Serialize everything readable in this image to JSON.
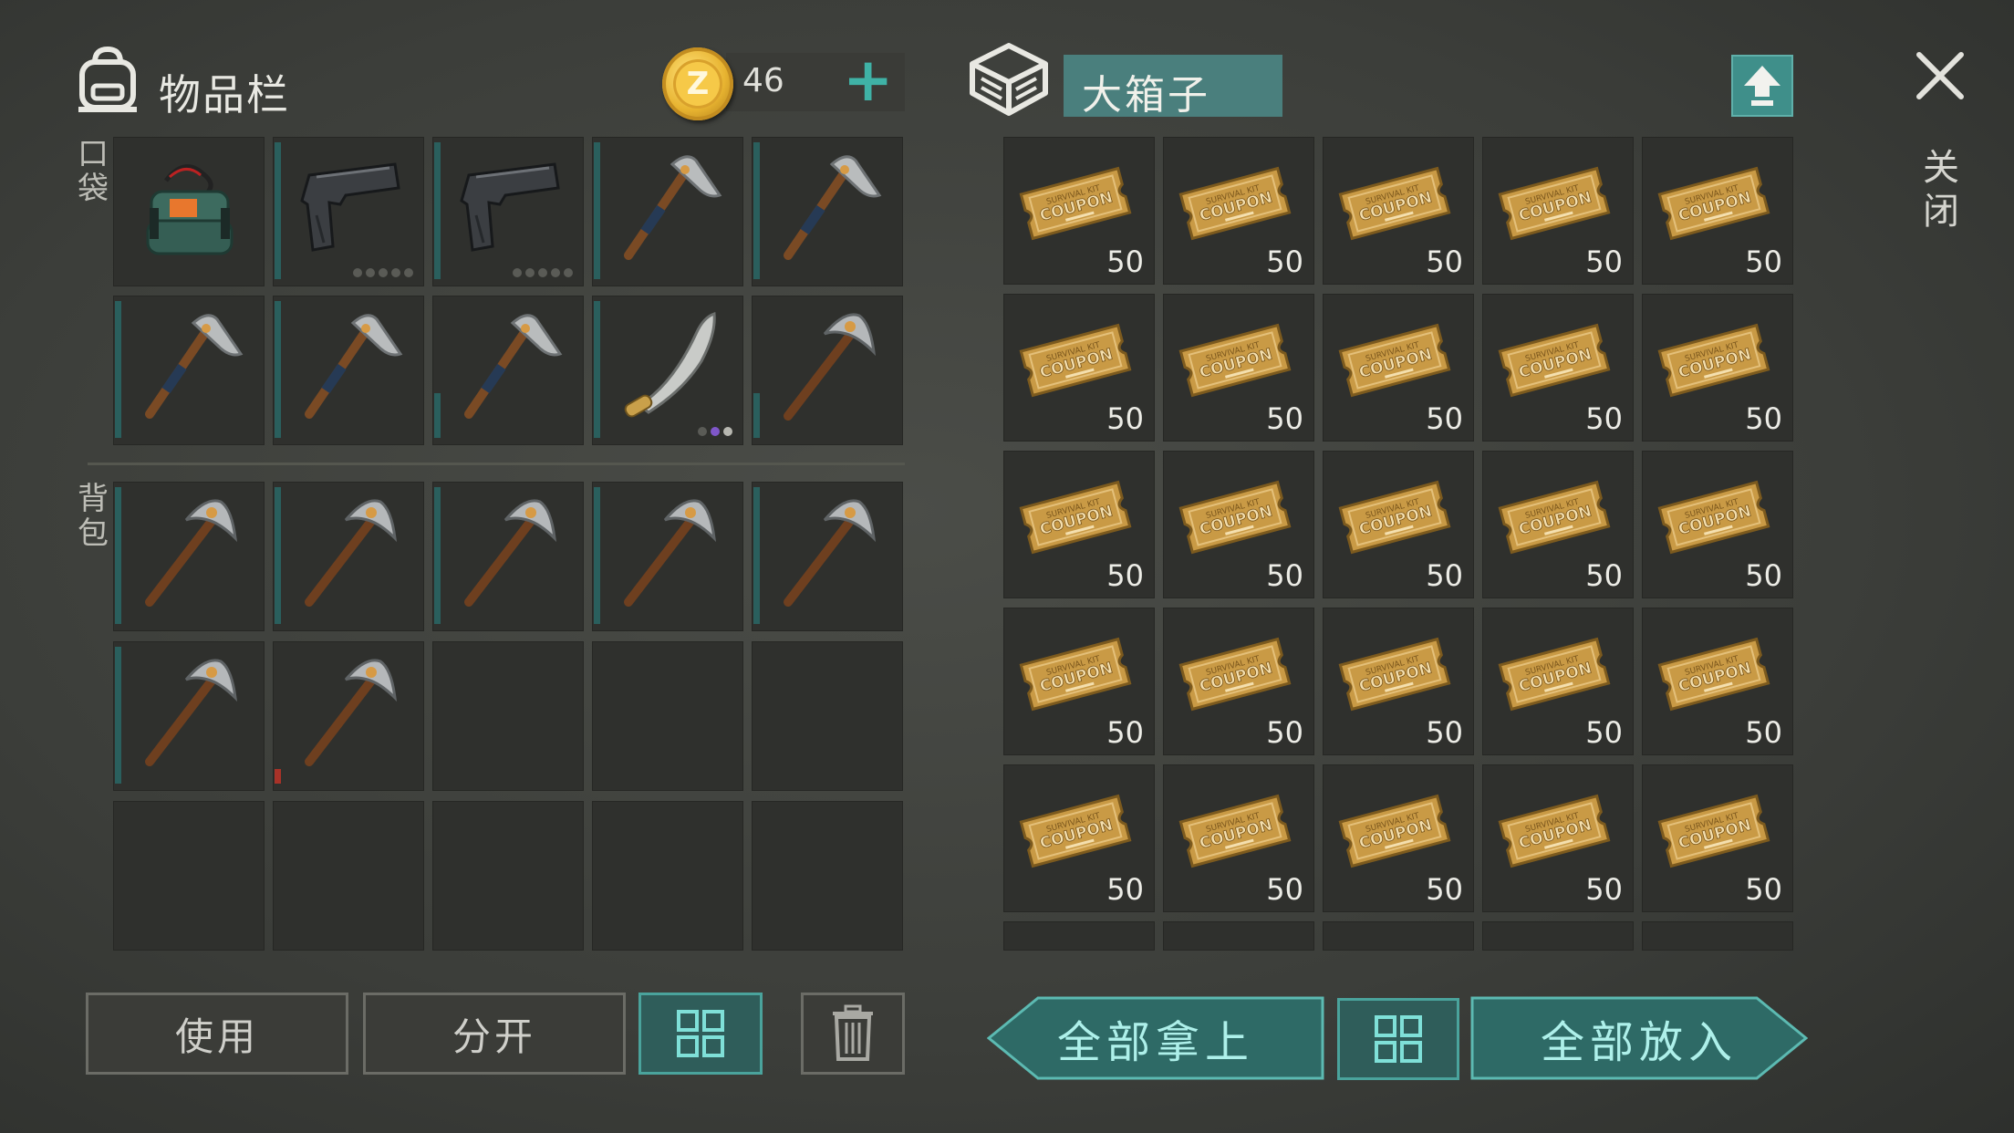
{
  "inventory": {
    "title": "物品栏",
    "pocket_label": "口袋",
    "backpack_label": "背包",
    "currency": "46",
    "add_symbol": "+",
    "pocket_items": [
      {
        "name": "explosive-c4-icon",
        "kind": "c4",
        "bar": "none"
      },
      {
        "name": "pistol-icon",
        "kind": "pistol",
        "bar": "full",
        "dots": [
          "d",
          "d",
          "d",
          "d",
          "d"
        ]
      },
      {
        "name": "pistol-icon",
        "kind": "pistol",
        "bar": "full",
        "dots": [
          "d",
          "d",
          "d",
          "d",
          "d"
        ]
      },
      {
        "name": "hatchet-icon",
        "kind": "hatchet",
        "bar": "full"
      },
      {
        "name": "hatchet-icon",
        "kind": "hatchet",
        "bar": "full"
      },
      {
        "name": "hatchet-icon",
        "kind": "hatchet",
        "bar": "full"
      },
      {
        "name": "hatchet-icon",
        "kind": "hatchet",
        "bar": "full"
      },
      {
        "name": "hatchet-icon",
        "kind": "hatchet",
        "bar": "half"
      },
      {
        "name": "machete-icon",
        "kind": "machete",
        "bar": "full",
        "dots": [
          "d",
          "p",
          "l"
        ]
      },
      {
        "name": "pickaxe-icon",
        "kind": "pick",
        "bar": "half"
      }
    ],
    "backpack_items": [
      {
        "name": "pickaxe-icon",
        "kind": "pick",
        "bar": "full"
      },
      {
        "name": "pickaxe-icon",
        "kind": "pick",
        "bar": "full"
      },
      {
        "name": "pickaxe-icon",
        "kind": "pick",
        "bar": "full"
      },
      {
        "name": "pickaxe-icon",
        "kind": "pick",
        "bar": "full"
      },
      {
        "name": "pickaxe-icon",
        "kind": "pick",
        "bar": "full"
      },
      {
        "name": "pickaxe-icon",
        "kind": "pick",
        "bar": "full"
      },
      {
        "name": "pickaxe-icon",
        "kind": "pick",
        "bar": "red"
      },
      {
        "name": "empty",
        "kind": "empty"
      },
      {
        "name": "empty",
        "kind": "empty"
      },
      {
        "name": "empty",
        "kind": "empty"
      },
      {
        "name": "empty",
        "kind": "empty"
      },
      {
        "name": "empty",
        "kind": "empty"
      },
      {
        "name": "empty",
        "kind": "empty"
      },
      {
        "name": "empty",
        "kind": "empty"
      },
      {
        "name": "empty",
        "kind": "empty"
      }
    ],
    "buttons": {
      "use": "使用",
      "split": "分开"
    }
  },
  "box": {
    "title": "大箱子",
    "coupon_text_top": "SURVIVAL KIT",
    "coupon_text_main": "COUPON",
    "coupon_qty": "50",
    "coupon_count": 25,
    "take_all": "全部拿上",
    "put_all": "全部放入"
  },
  "close_label": "关闭",
  "colors": {
    "accent": "#3fb2a6",
    "slot": "#2f302d",
    "coupon": "#c99a45"
  }
}
